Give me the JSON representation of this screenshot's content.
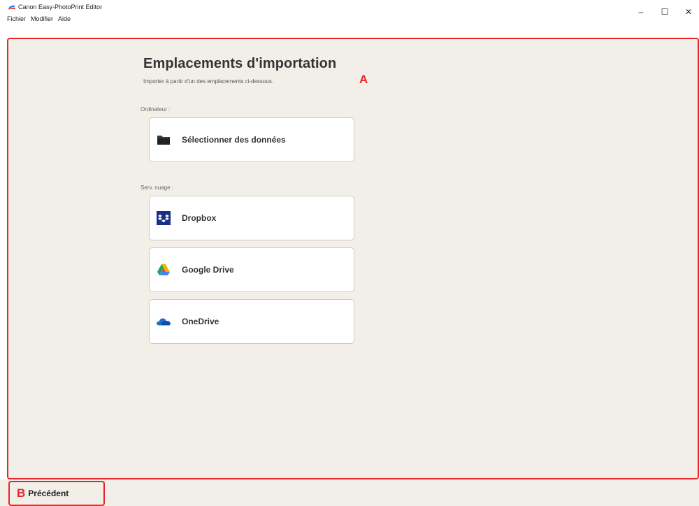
{
  "window": {
    "title": "Canon Easy-PhotoPrint Editor",
    "min_symbol": "–",
    "max_symbol": "☐",
    "close_symbol": "✕"
  },
  "menu": {
    "items": [
      "Fichier",
      "Modifier",
      "Aide"
    ]
  },
  "page": {
    "title": "Emplacements d'importation",
    "subtitle": "Importer à partir d'un des emplacements ci-dessous."
  },
  "sections": {
    "computer_label": "Ordinateur :",
    "cloud_label": "Serv. nuage :"
  },
  "sources": {
    "select_data": "Sélectionner des données",
    "dropbox": "Dropbox",
    "google_drive": "Google Drive",
    "onedrive": "OneDrive"
  },
  "icons": {
    "select_data": "folder-icon",
    "dropbox": "dropbox-icon",
    "google_drive": "google-drive-icon",
    "onedrive": "onedrive-icon"
  },
  "annotations": {
    "a": "A",
    "b": "B"
  },
  "footer": {
    "back_label": "Précédent"
  },
  "colors": {
    "background": "#f2efe9",
    "highlight": "#e8262b",
    "dropbox": "#1a2f8a"
  }
}
